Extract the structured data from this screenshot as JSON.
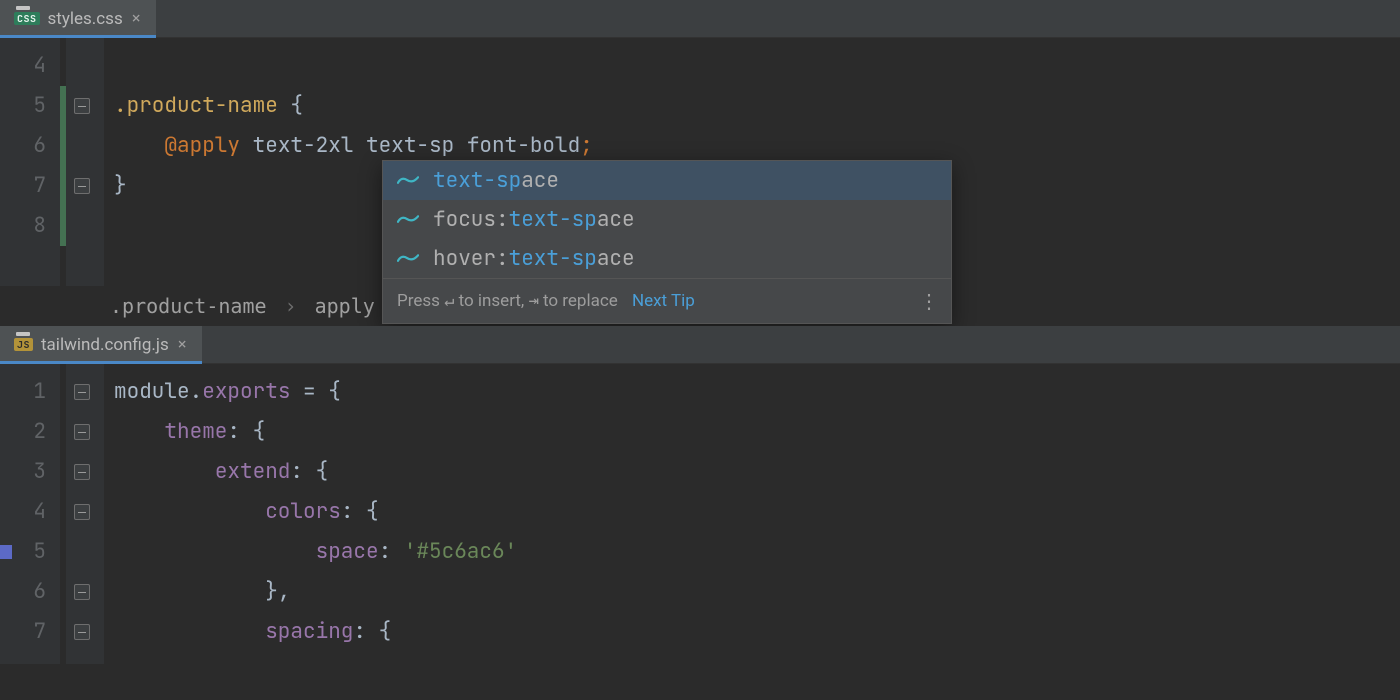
{
  "top": {
    "tab": {
      "badge": "CSS",
      "label": "styles.css"
    },
    "lines": [
      "4",
      "5",
      "6",
      "7",
      "8"
    ],
    "code": {
      "selector": ".product-name",
      "open": "{",
      "directive": "@apply",
      "vals": "text-2xl text-sp font-bold",
      "semi": ";",
      "close": "}"
    },
    "breadcrumbs": {
      "a": ".product-name",
      "b": "apply"
    }
  },
  "popup": {
    "items": [
      {
        "prefix": "",
        "match": "text-sp",
        "rest": "ace"
      },
      {
        "prefix": "focus:",
        "match": "text-sp",
        "rest": "ace"
      },
      {
        "prefix": "hover:",
        "match": "text-sp",
        "rest": "ace"
      }
    ],
    "hint_a": "Press ",
    "hint_b": " to insert, ",
    "hint_c": " to replace",
    "next_tip": "Next Tip"
  },
  "bottom": {
    "tab": {
      "badge": "JS",
      "label": "tailwind.config.js"
    },
    "lines": [
      "1",
      "2",
      "3",
      "4",
      "5",
      "6",
      "7"
    ],
    "code": {
      "l1a": "module",
      "l1b": ".",
      "l1c": "exports",
      "l1d": " = {",
      "l2a": "theme",
      "l2b": ": {",
      "l3a": "extend",
      "l3b": ": {",
      "l4a": "colors",
      "l4b": ": {",
      "l5a": "space",
      "l5b": ": ",
      "l5c": "'#5c6ac6'",
      "l6": "},",
      "l7a": "spacing",
      "l7b": ": {"
    }
  }
}
